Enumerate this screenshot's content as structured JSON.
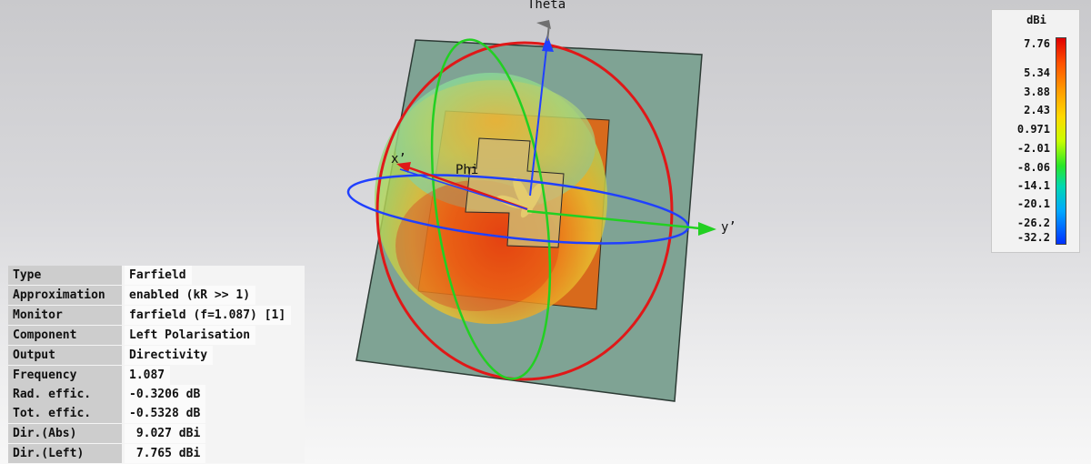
{
  "scene": {
    "axes": {
      "theta_label": "Theta",
      "phi_label": "Phi",
      "x_label": "x’",
      "y_label": "y’"
    }
  },
  "legend": {
    "unit": "dBi",
    "ticks": [
      "7.76",
      "5.34",
      "3.88",
      "2.43",
      "0.971",
      "-2.01",
      "-8.06",
      "-14.1",
      "-20.1",
      "-26.2",
      "-32.2"
    ],
    "colors": {
      "max": "#e00000",
      "high": "#ff9a00",
      "mid": "#ffd800",
      "midlow": "#28e628",
      "low": "#00a8ff",
      "min": "#0030ff"
    }
  },
  "info": {
    "rows": [
      {
        "key": "Type",
        "value": "Farfield"
      },
      {
        "key": "Approximation",
        "value": "enabled (kR >> 1)"
      },
      {
        "key": "Monitor",
        "value": "farfield (f=1.087) [1]"
      },
      {
        "key": "Component",
        "value": "Left Polarisation"
      },
      {
        "key": "Output",
        "value": "Directivity"
      },
      {
        "key": "Frequency",
        "value": "1.087"
      },
      {
        "key": "Rad. effic.",
        "value": "-0.3206 dB"
      },
      {
        "key": "Tot. effic.",
        "value": "-0.5328 dB"
      },
      {
        "key": "Dir.(Abs)",
        "value": " 9.027 dBi"
      },
      {
        "key": "Dir.(Left)",
        "value": " 7.765 dBi"
      }
    ]
  }
}
